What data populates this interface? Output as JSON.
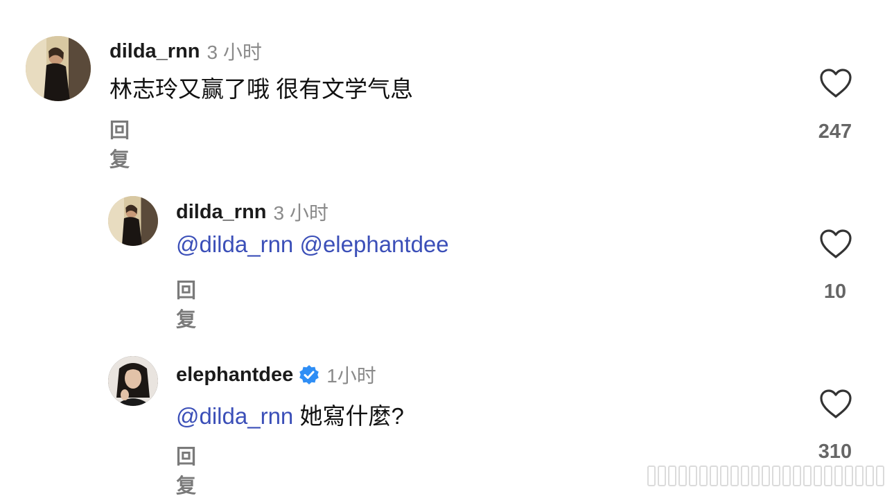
{
  "comments": [
    {
      "username": "dilda_rnn",
      "time": "3 小时",
      "text": "林志玲又赢了哦 很有文学气息",
      "reply_label": "回复",
      "likes": "247",
      "avatar_icon": "avatar-photo",
      "verified": false
    },
    {
      "username": "dilda_rnn",
      "time": "3 小时",
      "mentions": [
        "@dilda_rnn",
        "@elephantdee"
      ],
      "reply_label": "回复",
      "likes": "10",
      "avatar_icon": "avatar-photo",
      "verified": false
    },
    {
      "username": "elephantdee",
      "time": "1小时",
      "mention": "@dilda_rnn",
      "text": "她寫什麼?",
      "reply_label": "回复",
      "likes": "310",
      "avatar_icon": "avatar-photo",
      "verified": true,
      "verified_icon": "verified-badge-icon"
    }
  ],
  "colors": {
    "mention": "#3b4fb8",
    "verified": "#2f8ef5",
    "muted": "#8a8a8a"
  }
}
